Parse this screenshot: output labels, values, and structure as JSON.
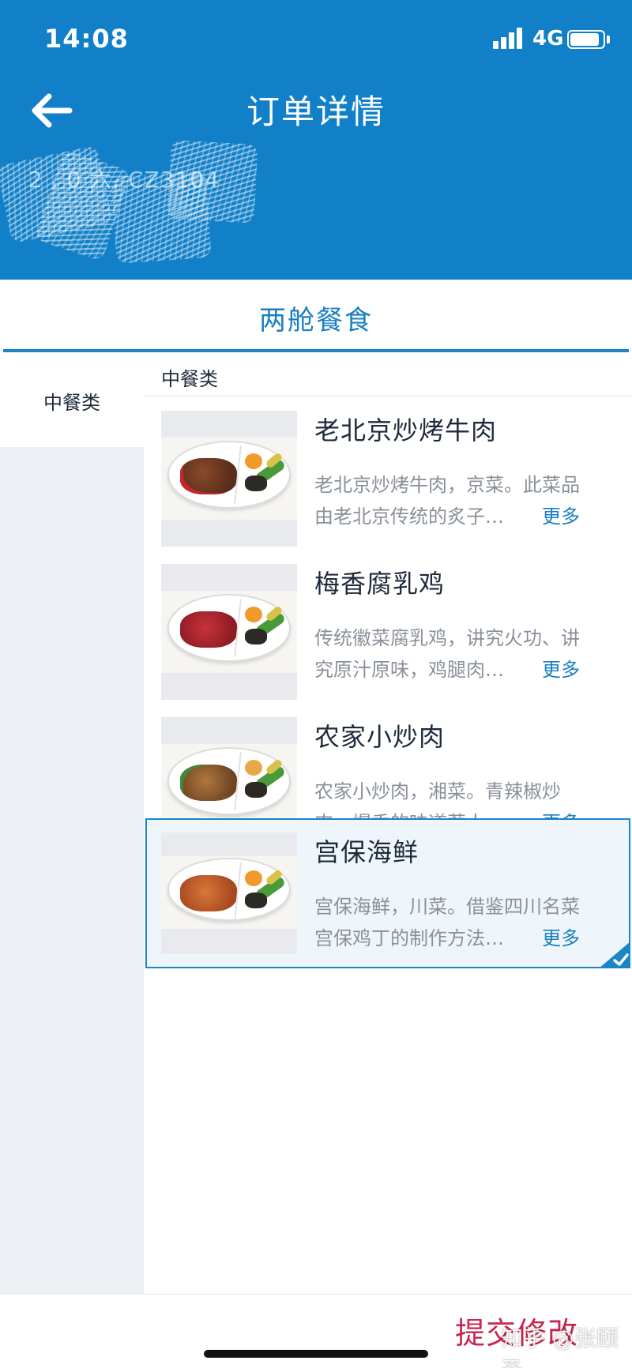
{
  "status_bar": {
    "time": "14:08",
    "network": "4G"
  },
  "header": {
    "title": "订单详情",
    "flight_info": "2  ,   0    六, CZ3104"
  },
  "section": {
    "title": "两舱餐食"
  },
  "sidebar": {
    "items": [
      {
        "label": "中餐类",
        "active": true
      }
    ]
  },
  "category": {
    "title": "中餐类"
  },
  "dishes": [
    {
      "name": "老北京炒烤牛肉",
      "desc_line1": "老北京炒烤牛肉，京菜。此菜品",
      "desc_line2": "由老北京传统的炙子…",
      "more": "更多",
      "selected": false
    },
    {
      "name": "梅香腐乳鸡",
      "desc_line1": "传统徽菜腐乳鸡，讲究火功、讲",
      "desc_line2": "究原汁原味，鸡腿肉…",
      "more": "更多",
      "selected": false
    },
    {
      "name": "农家小炒肉",
      "desc_line1": "农家小炒肉，湘菜。青辣椒炒",
      "desc_line2": "肉，爆香的味道惹人…",
      "more": "更多",
      "selected": false
    },
    {
      "name": "宫保海鲜",
      "desc_line1": "宫保海鲜，川菜。借鉴四川名菜",
      "desc_line2": "宫保鸡丁的制作方法…",
      "more": "更多",
      "selected": true
    }
  ],
  "footer": {
    "submit_label": "提交修改",
    "watermark": "知乎 @张颐圣"
  },
  "colors": {
    "header_bg": "#1180c8",
    "accent": "#1a86c8",
    "submit": "#c8254f"
  },
  "icons": {
    "back": "arrow-left-icon",
    "check": "check-corner-icon"
  }
}
